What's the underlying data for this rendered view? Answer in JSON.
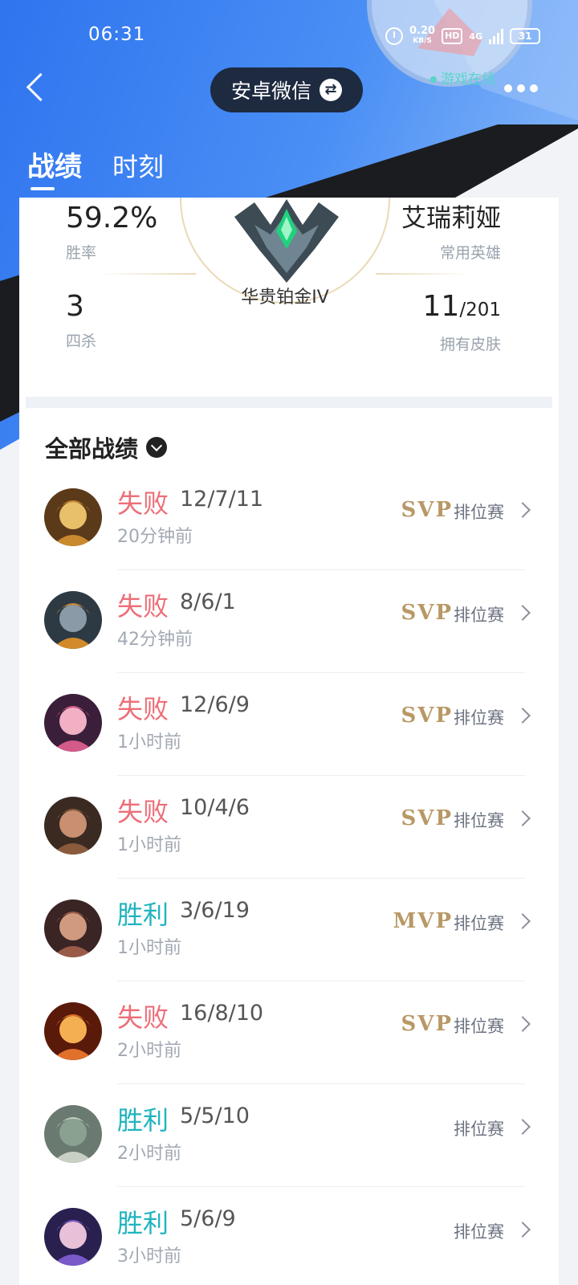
{
  "status_bar": {
    "time": "06:31",
    "speed_value": "0.20",
    "speed_unit": "KB/S",
    "hd": "HD",
    "network": "4G",
    "battery": "31"
  },
  "header": {
    "switch_label": "安卓微信",
    "online_status": "游戏在线"
  },
  "tabs": [
    {
      "label": "战绩",
      "active": true
    },
    {
      "label": "时刻",
      "active": false
    }
  ],
  "stats": {
    "win_rate": {
      "value": "59.2%",
      "label": "胜率"
    },
    "quadra_kills": {
      "value": "3",
      "label": "四杀"
    },
    "rank": {
      "label": "华贵铂金IV"
    },
    "common_hero": {
      "value": "艾瑞莉娅",
      "label": "常用英雄"
    },
    "skins": {
      "owned": "11",
      "total": "/201",
      "label": "拥有皮肤"
    }
  },
  "section": {
    "title": "全部战绩"
  },
  "matches": [
    {
      "result": "失败",
      "outcome": "lose",
      "kda": "12/7/11",
      "time": "20分钟前",
      "badge": "SVP",
      "mode": "排位赛",
      "avatar": "hero-avatar-1"
    },
    {
      "result": "失败",
      "outcome": "lose",
      "kda": "8/6/1",
      "time": "42分钟前",
      "badge": "SVP",
      "mode": "排位赛",
      "avatar": "hero-avatar-2"
    },
    {
      "result": "失败",
      "outcome": "lose",
      "kda": "12/6/9",
      "time": "1小时前",
      "badge": "SVP",
      "mode": "排位赛",
      "avatar": "hero-avatar-3"
    },
    {
      "result": "失败",
      "outcome": "lose",
      "kda": "10/4/6",
      "time": "1小时前",
      "badge": "SVP",
      "mode": "排位赛",
      "avatar": "hero-avatar-4"
    },
    {
      "result": "胜利",
      "outcome": "win",
      "kda": "3/6/19",
      "time": "1小时前",
      "badge": "MVP",
      "mode": "排位赛",
      "avatar": "hero-avatar-5"
    },
    {
      "result": "失败",
      "outcome": "lose",
      "kda": "16/8/10",
      "time": "2小时前",
      "badge": "SVP",
      "mode": "排位赛",
      "avatar": "hero-avatar-6"
    },
    {
      "result": "胜利",
      "outcome": "win",
      "kda": "5/5/10",
      "time": "2小时前",
      "badge": "",
      "mode": "排位赛",
      "avatar": "hero-avatar-7"
    },
    {
      "result": "胜利",
      "outcome": "win",
      "kda": "5/6/9",
      "time": "3小时前",
      "badge": "",
      "mode": "排位赛",
      "avatar": "hero-avatar-8"
    }
  ],
  "colors": {
    "header_blue": "#3a7ff0",
    "dark_band": "#1b1c20",
    "lose": "#ec6e78",
    "win": "#21b4bf",
    "badge_gold": "#b89865"
  }
}
